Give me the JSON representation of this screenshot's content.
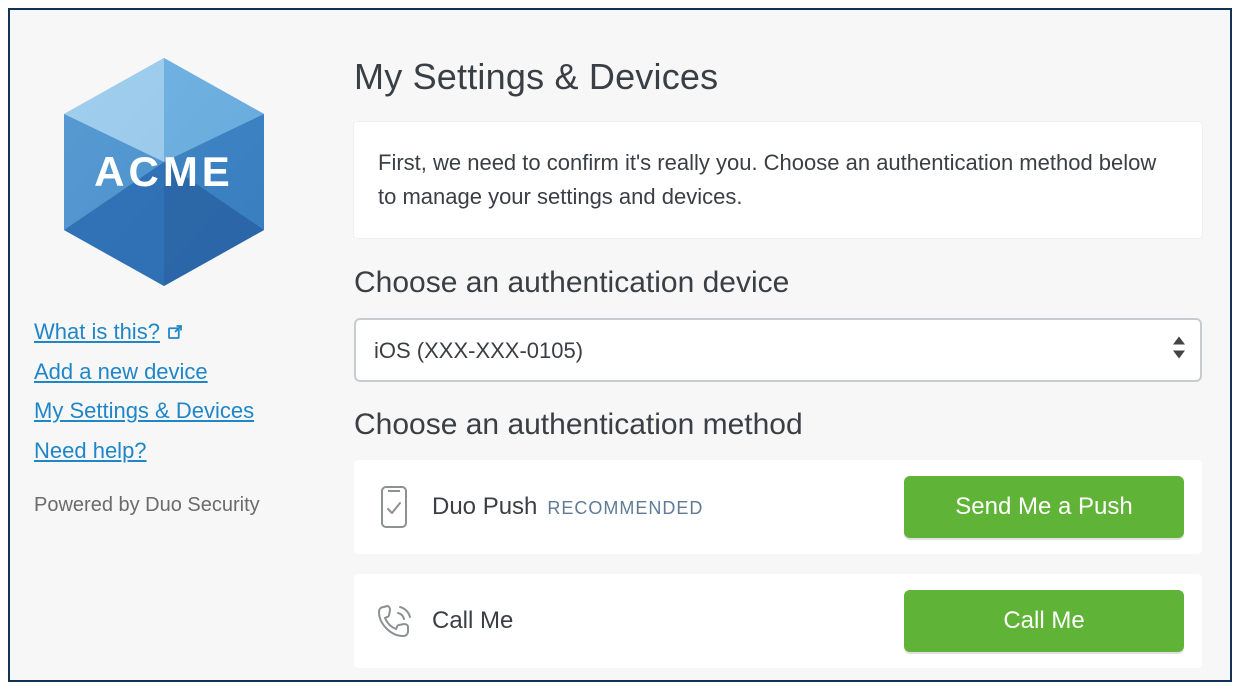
{
  "brand": {
    "name": "ACME"
  },
  "sidebar": {
    "links": [
      {
        "label": "What is this?",
        "icon": "external"
      },
      {
        "label": "Add a new device"
      },
      {
        "label": "My Settings & Devices"
      },
      {
        "label": "Need help?"
      }
    ],
    "footer": "Powered by Duo Security"
  },
  "main": {
    "title": "My Settings & Devices",
    "info": "First, we need to confirm it's really you. Choose an authentication method below to manage your settings and devices.",
    "device_heading": "Choose an authentication device",
    "device_selected": "iOS (XXX-XXX-0105)",
    "method_heading": "Choose an authentication method",
    "methods": [
      {
        "label": "Duo Push",
        "badge": "RECOMMENDED",
        "button": "Send Me a Push",
        "icon": "phone-check"
      },
      {
        "label": "Call Me",
        "button": "Call Me",
        "icon": "phone-ring"
      }
    ]
  },
  "colors": {
    "link": "#1f86c7",
    "button": "#5fb336",
    "border": "#113355"
  }
}
